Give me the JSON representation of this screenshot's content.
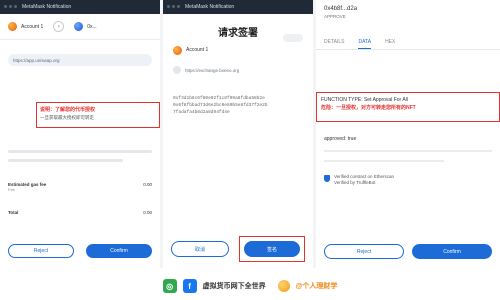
{
  "left": {
    "titlebar": "MetaMask Notification",
    "from_account": "Account 1",
    "to_account": "0x...",
    "origin": "https://app.uniswap.org",
    "banner_line1": "说明：了解您的代币授权",
    "banner_line2": "一旦获取最大授权即可转走",
    "fee_label": "Estimated gas fee",
    "fee_sublabel": "Fee",
    "fee_value": "0.00",
    "total_label": "Total",
    "total_value": "0.00",
    "reject_label": "Reject",
    "confirm_label": "Confirm"
  },
  "middle": {
    "title": "请求签署",
    "account": "Account 1",
    "origin": "https://exchange.bxeeo.org",
    "hash_lines": [
      "0xf3d1b8c6f60e02f1c8f09a8fdba58b2e",
      "0x6f8fbbad73d6e2bc0e80b5e8fd37f2e2b",
      "7fadafa4b8d2a8d94fd4e"
    ],
    "cancel_label": "取消",
    "sign_label": "签名"
  },
  "right": {
    "title": "0x4b8f...d2a",
    "subtitle": "APPROVE",
    "tabs": [
      "DETAILS",
      "DATA",
      "HEX"
    ],
    "active_tab": "DATA",
    "box_line1": "FUNCTION TYPE: Set Approval For All",
    "box_line2": "危险：一旦授权，对方可转走您所有的NFT",
    "approved_label": "approved: true",
    "verified_line1": "Verified contract on Etherscan",
    "verified_line2": "Verified by TruffleBot",
    "cancel_label": "Reject",
    "confirm_label": "Confirm"
  },
  "footer": {
    "icon1": "wechat-icon",
    "icon2": "facebook-icon",
    "text1": "虚拟货币网下全世界",
    "text2": "@个人理财学"
  },
  "colors": {
    "accent": "#1c6bd6",
    "warning": "#e4322f",
    "titlebar": "#1f2a36"
  }
}
